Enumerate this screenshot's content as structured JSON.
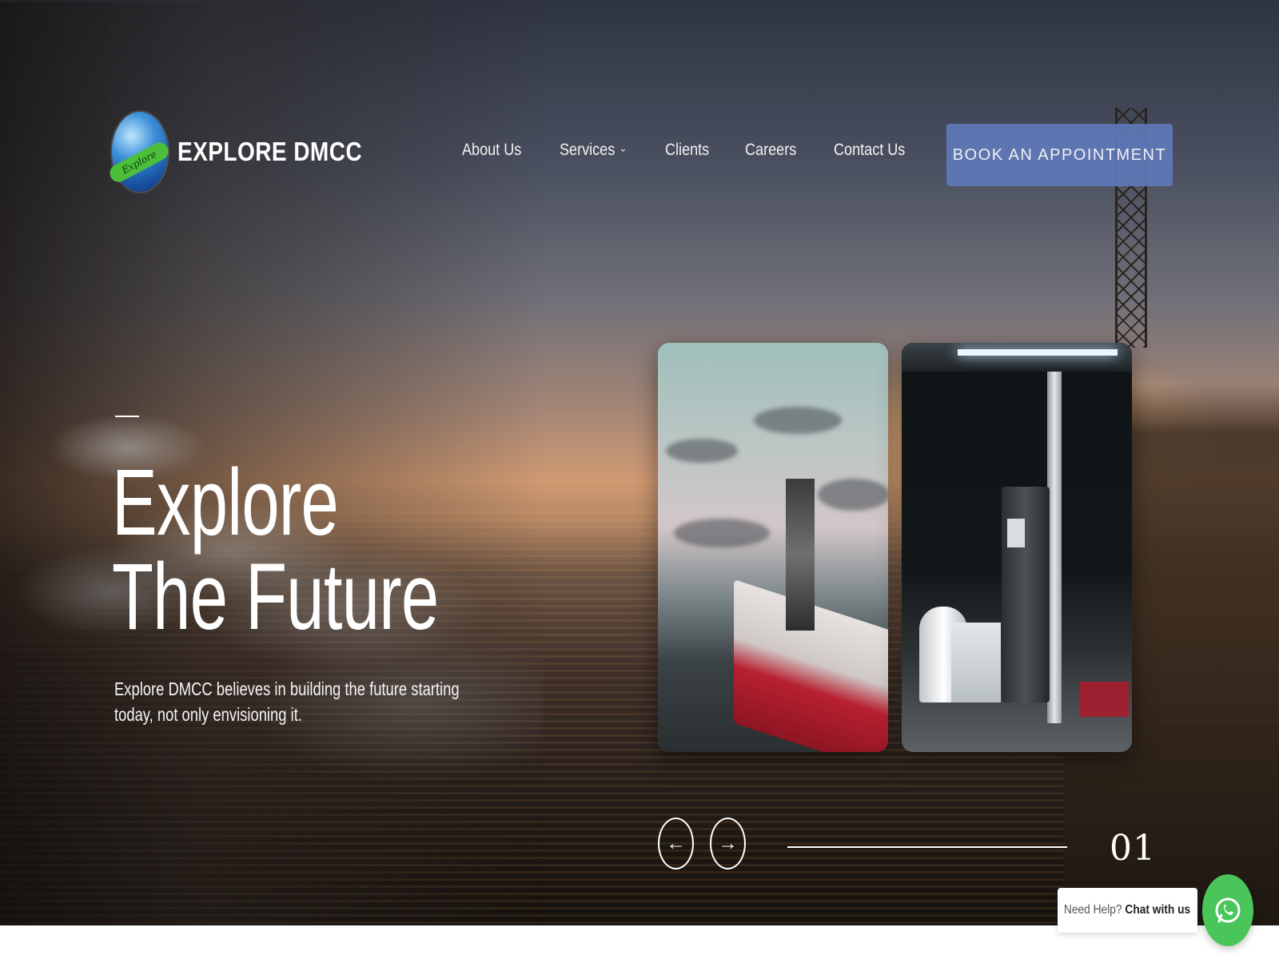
{
  "brand": {
    "name": "EXPLORE DMCC",
    "logo_band_text": "Explore"
  },
  "nav": {
    "items": [
      {
        "label": "About Us",
        "has_dropdown": false
      },
      {
        "label": "Services",
        "has_dropdown": true
      },
      {
        "label": "Clients",
        "has_dropdown": false
      },
      {
        "label": "Careers",
        "has_dropdown": false
      },
      {
        "label": "Contact Us",
        "has_dropdown": false
      }
    ],
    "dropdown_icon": "chevron-down-icon"
  },
  "cta": {
    "label": "BOOK AN APPOINTMENT",
    "color": "#5f79b8"
  },
  "hero": {
    "headline_line1": "Explore",
    "headline_line2": "The Future",
    "subtext": "Explore DMCC believes in building the future starting today, not only envisioning it.",
    "background": "offshore oil rig and pipelines at sunset"
  },
  "cards": [
    {
      "image": "offshore-vessel-at-sea"
    },
    {
      "image": "fuel-pump-station-at-night"
    }
  ],
  "slider": {
    "prev_icon": "arrow-left-icon",
    "next_icon": "arrow-right-icon",
    "slide_number": "01",
    "progress": 1.0
  },
  "chat": {
    "prefix": "Need Help?",
    "action": "Chat with us",
    "icon": "whatsapp-icon",
    "color": "#49c55a"
  }
}
